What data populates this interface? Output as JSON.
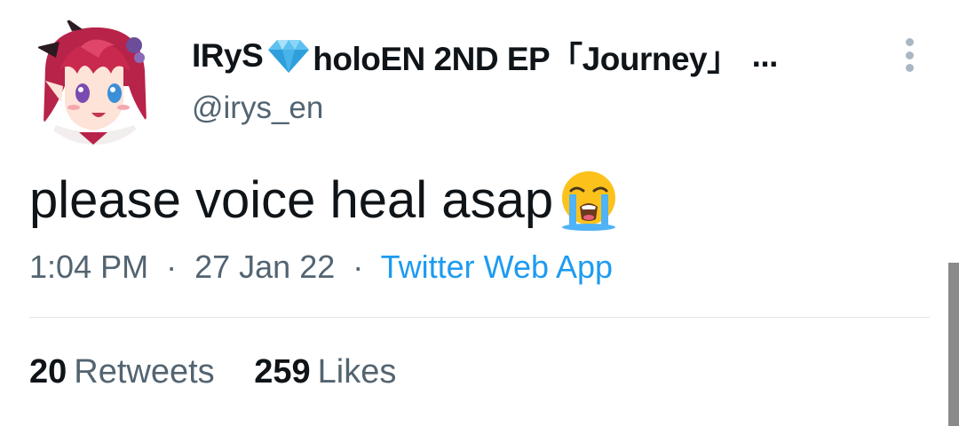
{
  "author": {
    "display_name_part1": "IRyS",
    "display_name_part2": "holoEN 2ND EP「Journey」",
    "display_name_ellipsis": "...",
    "handle": "@irys_en",
    "avatar_icon": "anime-avatar-icon",
    "badge_icon": "blue-diamond-icon"
  },
  "tweet": {
    "text": "please voice heal asap",
    "emoji": "loudly-crying-face-icon",
    "time": "1:04 PM",
    "date": "27 Jan 22",
    "separator": "·",
    "source": "Twitter Web App"
  },
  "stats": {
    "retweets_count": "20",
    "retweets_label": "Retweets",
    "likes_count": "259",
    "likes_label": "Likes"
  },
  "colors": {
    "text": "#0f1419",
    "secondary": "#536471",
    "link": "#1d9bf0",
    "divider": "#e2e6ea"
  }
}
